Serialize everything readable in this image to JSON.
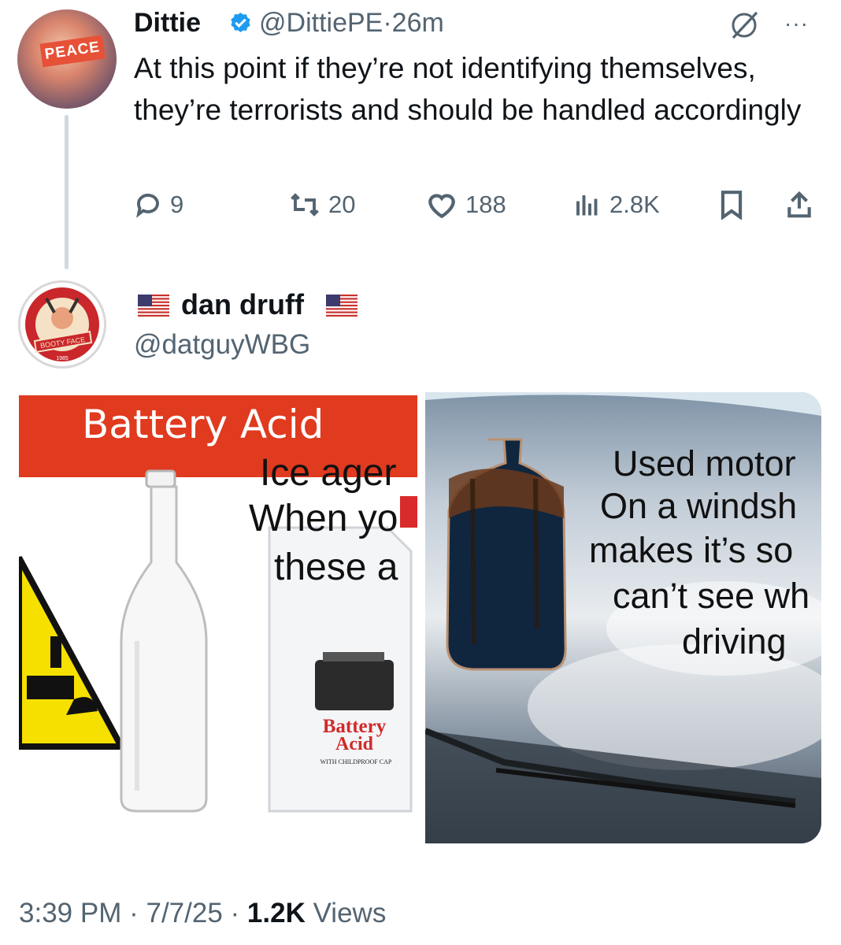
{
  "tweet": {
    "author_name": "Dittie",
    "author_handle": "@DittiePE",
    "separator": "·",
    "time_ago": "26m",
    "avatar_text": "PEACE",
    "text": "At this point if they’re not identifying themselves, they’re terrorists and should be handled accordingly",
    "actions": {
      "replies": "9",
      "reposts": "20",
      "likes": "188",
      "views": "2.8K"
    },
    "more_label": "···"
  },
  "quoted": {
    "author_name": "dan druff",
    "author_handle": "@datguyWBG",
    "avatar_text": "BOOTY FACE",
    "avatar_year": "1985",
    "media_left": {
      "banner": "Battery Acid",
      "caption_lines": [
        "Ice ager",
        "When yo",
        "these a"
      ],
      "jug_label_1": "Battery",
      "jug_label_2": "Acid",
      "jug_label_3": "WITH CHILDPROOF CAP"
    },
    "media_right": {
      "caption_lines": [
        "Used motor",
        "On a windsh",
        "makes it’s so",
        "can’t see wh",
        "driving"
      ]
    }
  },
  "footer": {
    "time": "3:39 PM",
    "date": "7/7/25",
    "views_count": "1.2K",
    "views_label": "Views",
    "separator": "·"
  },
  "colors": {
    "text_primary": "#0f1419",
    "text_secondary": "#536471",
    "verified_blue": "#1d9bf0",
    "banner_red": "#e03a1f"
  }
}
